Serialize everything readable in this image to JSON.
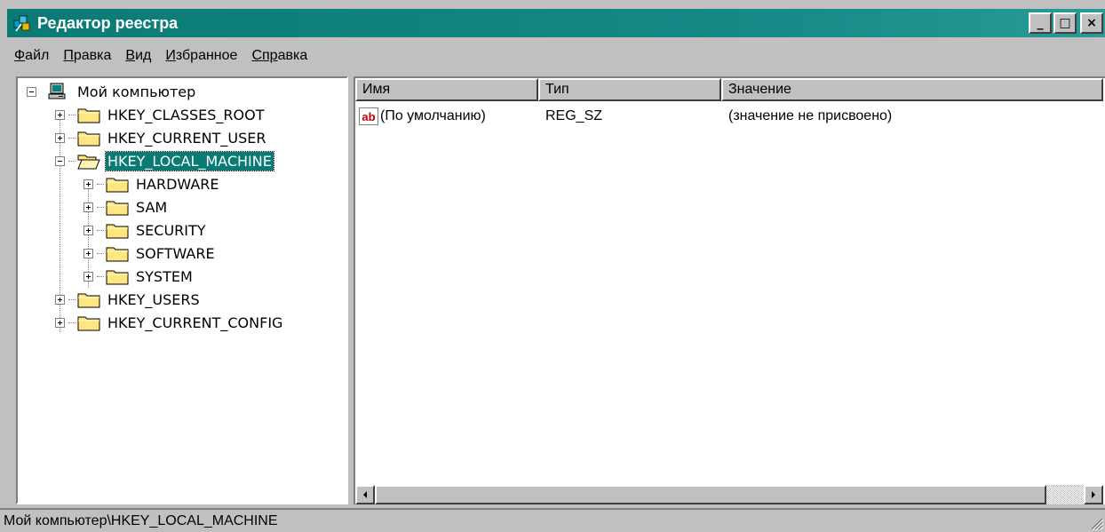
{
  "window": {
    "title": "Редактор реестра",
    "buttons": {
      "minimize": "_",
      "maximize": "□",
      "close": "×"
    }
  },
  "menu": {
    "items": [
      {
        "accel": "Ф",
        "rest": "айл"
      },
      {
        "accel": "П",
        "rest": "равка"
      },
      {
        "accel": "В",
        "rest": "ид"
      },
      {
        "accel": "И",
        "rest": "збранное"
      },
      {
        "accel": "Спр",
        "rest": "авка"
      }
    ]
  },
  "tree": {
    "root": "Мой компьютер",
    "hkcr": "HKEY_CLASSES_ROOT",
    "hkcu": "HKEY_CURRENT_USER",
    "hklm": "HKEY_LOCAL_MACHINE",
    "hardware": "HARDWARE",
    "sam": "SAM",
    "security": "SECURITY",
    "software": "SOFTWARE",
    "system": "SYSTEM",
    "hku": "HKEY_USERS",
    "hkcc": "HKEY_CURRENT_CONFIG"
  },
  "list": {
    "columns": {
      "name": "Имя",
      "type": "Тип",
      "value": "Значение"
    },
    "rows": [
      {
        "icon": "ab-string-icon",
        "icon_text": "ab",
        "name": "(По умолчанию)",
        "type": "REG_SZ",
        "value": "(значение не присвоено)"
      }
    ]
  },
  "status": {
    "path": "Мой компьютер\\HKEY_LOCAL_MACHINE"
  },
  "colors": {
    "titlebar": "#0a7a74",
    "selection": "#0a7a74",
    "face": "#c0c0c0",
    "folder": "#ffe680"
  }
}
